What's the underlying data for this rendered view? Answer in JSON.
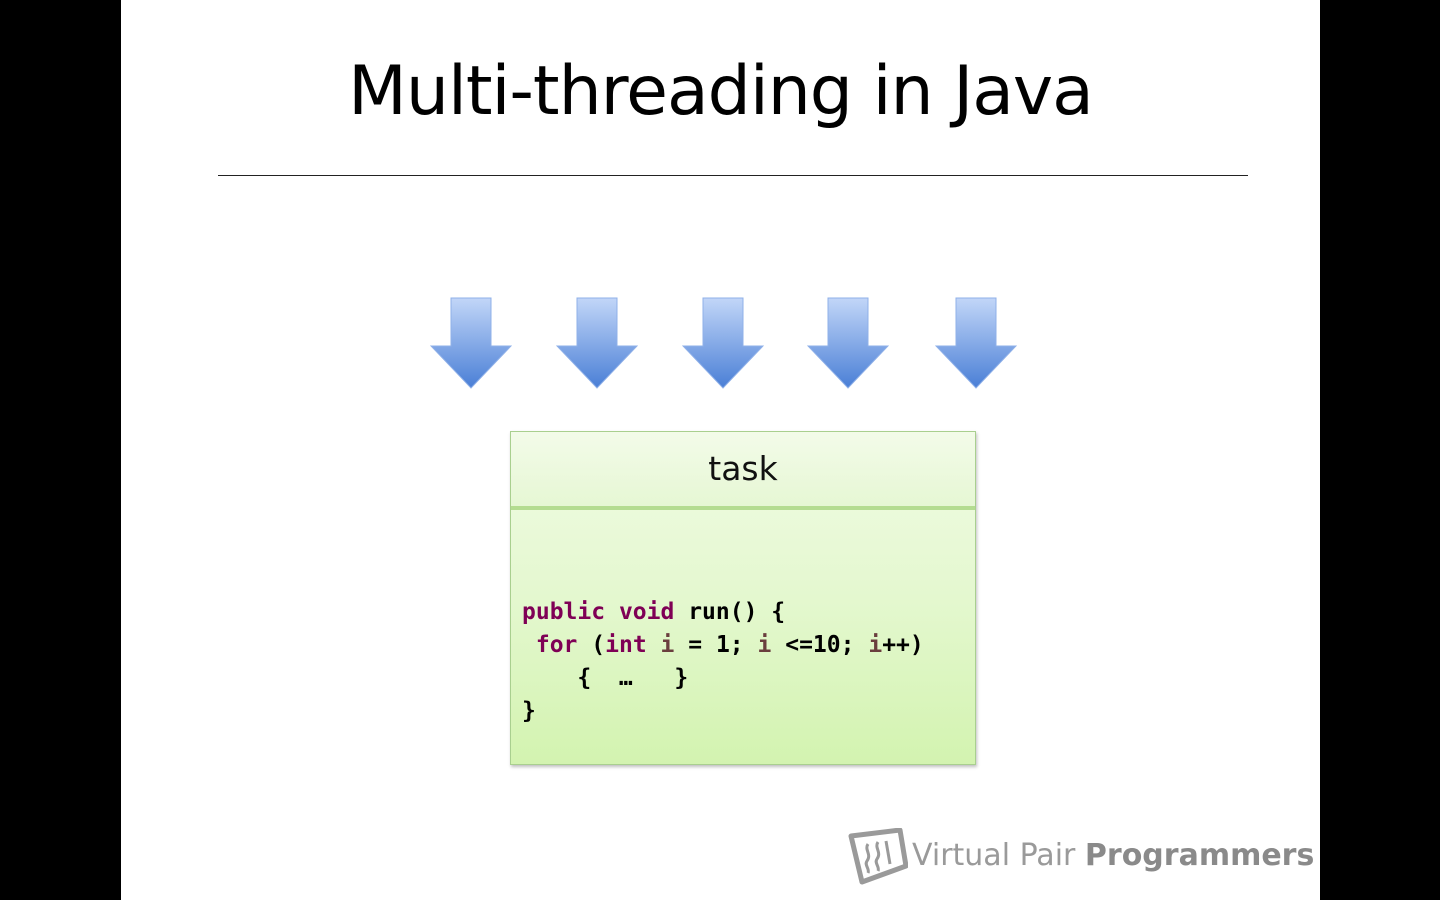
{
  "slide": {
    "title": "Multi-threading in Java"
  },
  "diagram": {
    "arrow_count": 5,
    "arrow_icon": "down-arrow-icon",
    "task_label": "task",
    "colors": {
      "arrow_top": "#b9d0f7",
      "arrow_bottom": "#4a7fd6",
      "box_fill": "#e4f8cf",
      "box_border": "#a9cf8f"
    }
  },
  "code": {
    "line1_kw1": "public",
    "line1_kw2": "void",
    "line1_rest": "run() {",
    "line2_kw1": "for",
    "line2_open": "(",
    "line2_kw2": "int",
    "line2_var1": "i",
    "line2_mid1": "= 1;",
    "line2_var2": "i",
    "line2_mid2": "<=10;",
    "line2_var3": "i",
    "line2_end": "++)",
    "line3": "{  …   }",
    "line4": "}"
  },
  "branding": {
    "logo_icon": "vpp-logo-icon",
    "brand_light": "Virtual Pair",
    "brand_bold": "Programmers"
  }
}
